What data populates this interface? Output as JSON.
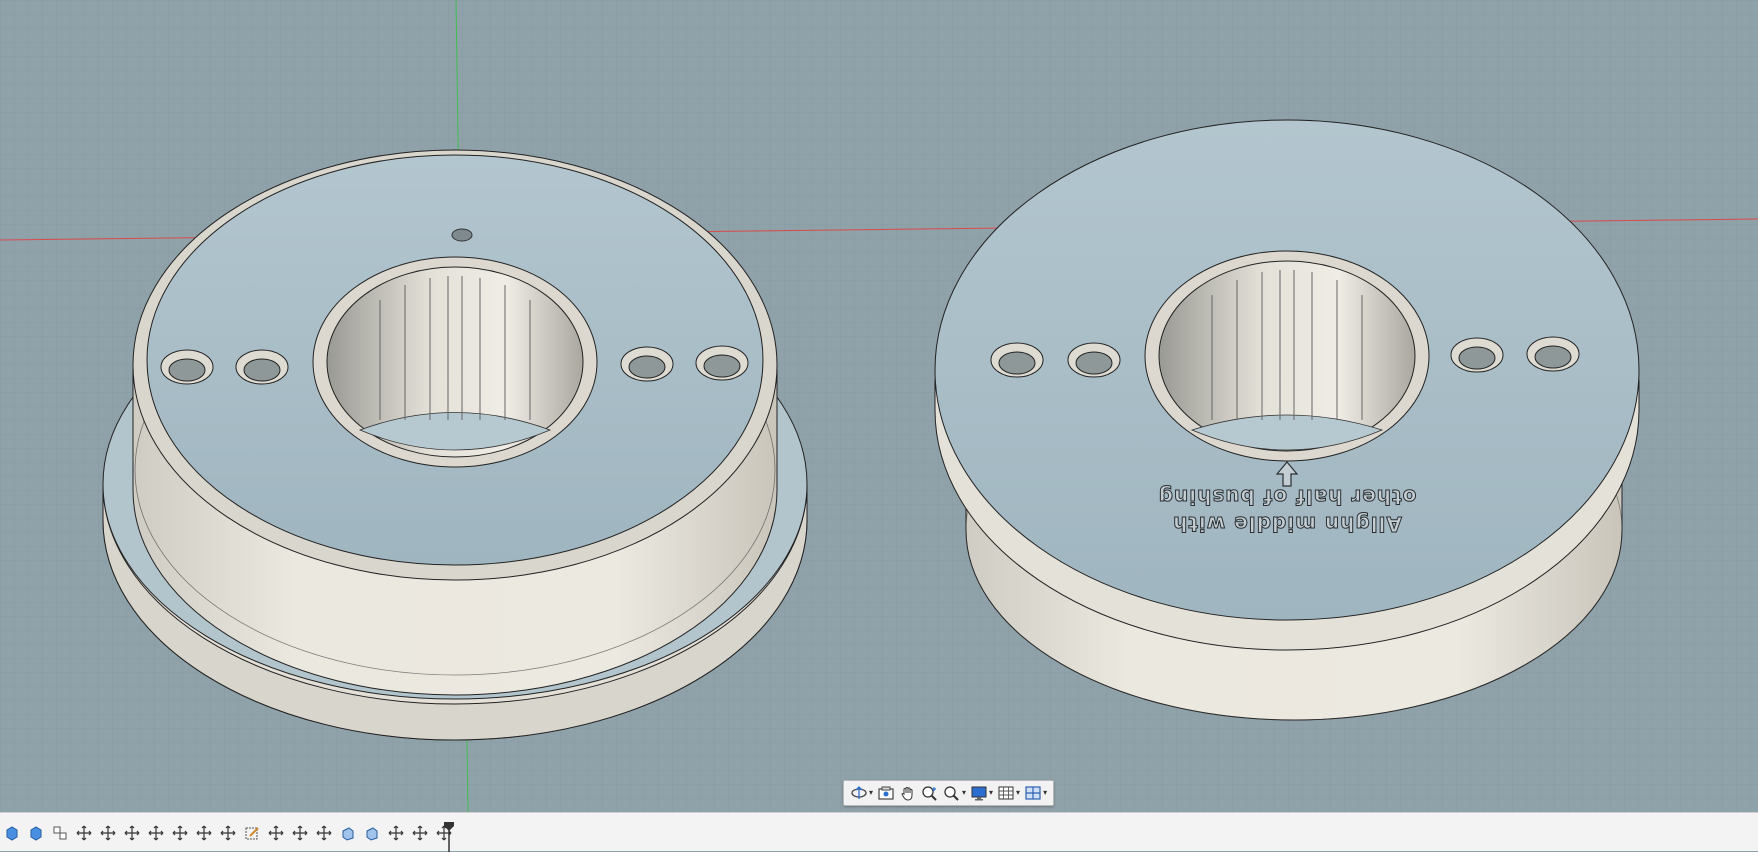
{
  "viewport": {
    "background_color": "#8fa1a9",
    "grid_color": "#7d9099",
    "axis_x_color": "#d94b4b",
    "axis_y_color": "#3fbf4f",
    "body_color": "#e8e4dc",
    "top_face_color": "#a9bfc9"
  },
  "engraving": {
    "line1": "Allghn middle with",
    "line2": "other half of bushing"
  },
  "navigation_bar": {
    "tools": [
      {
        "name": "orbit-icon",
        "caret": "▾"
      },
      {
        "name": "look-at-icon",
        "caret": ""
      },
      {
        "name": "pan-icon",
        "caret": ""
      },
      {
        "name": "zoom-icon",
        "caret": ""
      },
      {
        "name": "fit-icon",
        "caret": "▾"
      },
      {
        "name": "display-settings-icon",
        "caret": "▾"
      },
      {
        "name": "grid-snaps-icon",
        "caret": "▾"
      },
      {
        "name": "viewports-icon",
        "caret": "▾"
      }
    ]
  },
  "timeline": {
    "features": [
      "body-icon",
      "body-icon",
      "component-icon",
      "move-icon",
      "move-icon",
      "move-icon",
      "move-icon",
      "move-icon",
      "move-icon",
      "move-icon",
      "sketch-icon",
      "move-icon",
      "move-icon",
      "move-icon",
      "extrude-icon",
      "extrude-icon",
      "move-icon",
      "move-icon",
      "move-icon"
    ],
    "marker": "timeline-marker"
  }
}
